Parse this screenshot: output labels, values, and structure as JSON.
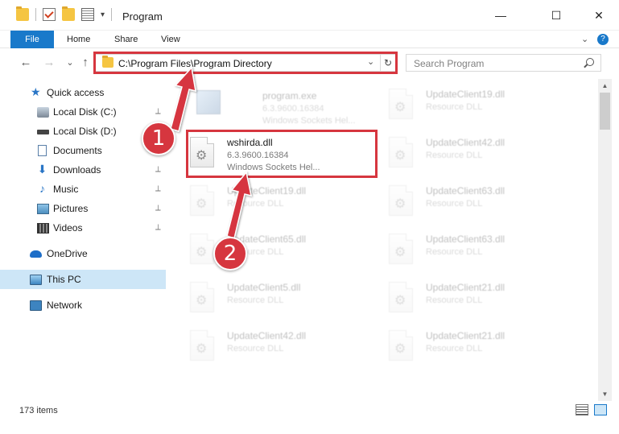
{
  "window": {
    "title": "Program",
    "minimize": "—",
    "maximize": "☐",
    "close": "✕"
  },
  "ribbon": {
    "tabs": [
      "File",
      "Home",
      "Share",
      "View"
    ],
    "expand": "⌄",
    "help": "?"
  },
  "nav": {
    "back": "←",
    "forward": "→",
    "recent": "⌄",
    "up": "↑"
  },
  "address": {
    "path": "C:\\Program Files\\Program Directory",
    "dropdown": "⌄",
    "refresh": "↻"
  },
  "search": {
    "placeholder": "Search Program"
  },
  "sidebar": {
    "items": [
      {
        "label": "Quick access",
        "pinned": false
      },
      {
        "label": "Local Disk (C:)",
        "pinned": true
      },
      {
        "label": "Local Disk (D:)",
        "pinned": false
      },
      {
        "label": "Documents",
        "pinned": true
      },
      {
        "label": "Downloads",
        "pinned": true
      },
      {
        "label": "Music",
        "pinned": true
      },
      {
        "label": "Pictures",
        "pinned": true
      },
      {
        "label": "Videos",
        "pinned": true
      },
      {
        "label": "OneDrive",
        "pinned": false
      },
      {
        "label": "This PC",
        "pinned": false
      },
      {
        "label": "Network",
        "pinned": false
      }
    ],
    "pin_glyph": "📌"
  },
  "files": {
    "left": [
      {
        "name": "program.exe",
        "line1": "6.3.9600.16384",
        "line2": "Windows Sockets Hel..."
      },
      {
        "name": "wshirda.dll",
        "line1": "6.3.9600.16384",
        "line2": "Windows Sockets Hel..."
      },
      {
        "name": "UpdateClient19.dll",
        "line1": "Resource DLL"
      },
      {
        "name": "UpdateClient65.dll",
        "line1": "Resource DLL"
      },
      {
        "name": "UpdateClient5.dll",
        "line1": "Resource DLL"
      },
      {
        "name": "UpdateClient42.dll",
        "line1": "Resource DLL"
      }
    ],
    "right": [
      {
        "name": "UpdateClient19.dll",
        "line1": "Resource DLL"
      },
      {
        "name": "UpdateClient42.dll",
        "line1": "Resource DLL"
      },
      {
        "name": "UpdateClient63.dll",
        "line1": "Resource DLL"
      },
      {
        "name": "UpdateClient63.dll",
        "line1": "Resource DLL"
      },
      {
        "name": "UpdateClient21.dll",
        "line1": "Resource DLL"
      },
      {
        "name": "UpdateClient21.dll",
        "line1": "Resource DLL"
      }
    ]
  },
  "status": {
    "count": "173 items"
  },
  "annotations": {
    "step1": "1",
    "step2": "2",
    "color": "#d6363f"
  },
  "scroll": {
    "up": "▲",
    "down": "▼"
  }
}
